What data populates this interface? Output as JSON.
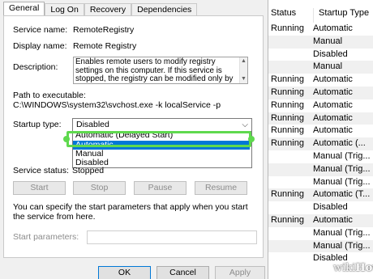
{
  "services": {
    "headers": {
      "status": "Status",
      "startup_type": "Startup Type"
    },
    "rows": [
      {
        "status": "Running",
        "type": "Automatic"
      },
      {
        "status": "",
        "type": "Manual"
      },
      {
        "status": "",
        "type": "Disabled"
      },
      {
        "status": "",
        "type": "Manual"
      },
      {
        "status": "Running",
        "type": "Automatic"
      },
      {
        "status": "Running",
        "type": "Automatic"
      },
      {
        "status": "Running",
        "type": "Automatic"
      },
      {
        "status": "Running",
        "type": "Automatic"
      },
      {
        "status": "Running",
        "type": "Automatic"
      },
      {
        "status": "Running",
        "type": "Automatic (..."
      },
      {
        "status": "",
        "type": "Manual (Trig..."
      },
      {
        "status": "",
        "type": "Manual (Trig..."
      },
      {
        "status": "",
        "type": "Manual (Trig..."
      },
      {
        "status": "Running",
        "type": "Automatic (T..."
      },
      {
        "status": "",
        "type": "Disabled"
      },
      {
        "status": "Running",
        "type": "Automatic"
      },
      {
        "status": "",
        "type": "Manual (Trig..."
      },
      {
        "status": "",
        "type": "Manual (Trig..."
      },
      {
        "status": "",
        "type": "Disabled"
      }
    ]
  },
  "dialog": {
    "tabs": [
      "General",
      "Log On",
      "Recovery",
      "Dependencies"
    ],
    "service_name_label": "Service name:",
    "service_name": "RemoteRegistry",
    "display_name_label": "Display name:",
    "display_name": "Remote Registry",
    "description_label": "Description:",
    "description": "Enables remote users to modify registry settings on this computer. If this service is stopped, the registry can be modified only by users on this computer. If",
    "path_label": "Path to executable:",
    "path": "C:\\WINDOWS\\system32\\svchost.exe -k localService -p",
    "startup_type_label": "Startup type:",
    "startup_type_value": "Disabled",
    "startup_options": [
      "Automatic (Delayed Start)",
      "Automatic",
      "Manual",
      "Disabled"
    ],
    "startup_selected_option": "Automatic",
    "service_status_label": "Service status:",
    "service_status": "Stopped",
    "buttons": {
      "start": "Start",
      "stop": "Stop",
      "pause": "Pause",
      "resume": "Resume"
    },
    "hint": "You can specify the start parameters that apply when you start the service from here.",
    "start_params_label": "Start parameters:",
    "start_params_value": "",
    "footer": {
      "ok": "OK",
      "cancel": "Cancel",
      "apply": "Apply"
    }
  },
  "watermark": {
    "prefix": "wiki",
    "suffix": "How"
  },
  "colors": {
    "highlight": "#5fd94e",
    "selection": "#0078d7"
  }
}
